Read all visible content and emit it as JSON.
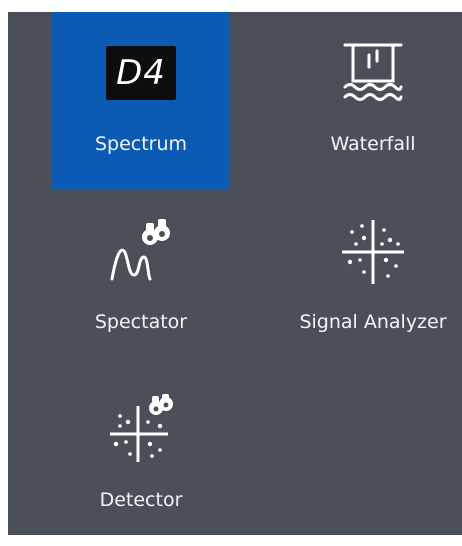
{
  "colors": {
    "panel_bg": "#4b4f58",
    "selected_bg": "#0b5bb5",
    "text": "#f3f4f6"
  },
  "tiles": [
    {
      "label": "Spectrum",
      "icon": "d4-logo-icon",
      "icon_text": "D4",
      "selected": true
    },
    {
      "label": "Waterfall",
      "icon": "waterfall-icon",
      "selected": false
    },
    {
      "label": "Spectator",
      "icon": "spectator-icon",
      "selected": false
    },
    {
      "label": "Signal Analyzer",
      "icon": "signal-analyzer-icon",
      "selected": false
    },
    {
      "label": "Detector",
      "icon": "detector-icon",
      "selected": false
    }
  ]
}
